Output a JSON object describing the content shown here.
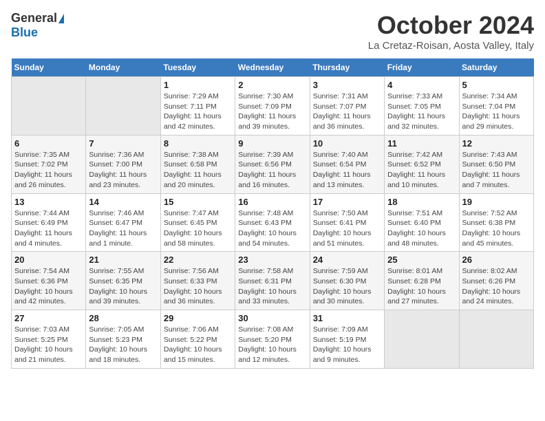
{
  "header": {
    "logo_general": "General",
    "logo_blue": "Blue",
    "month": "October 2024",
    "location": "La Cretaz-Roisan, Aosta Valley, Italy"
  },
  "calendar": {
    "weekdays": [
      "Sunday",
      "Monday",
      "Tuesday",
      "Wednesday",
      "Thursday",
      "Friday",
      "Saturday"
    ],
    "rows": [
      [
        {
          "day": "",
          "detail": ""
        },
        {
          "day": "",
          "detail": ""
        },
        {
          "day": "1",
          "detail": "Sunrise: 7:29 AM\nSunset: 7:11 PM\nDaylight: 11 hours and 42 minutes."
        },
        {
          "day": "2",
          "detail": "Sunrise: 7:30 AM\nSunset: 7:09 PM\nDaylight: 11 hours and 39 minutes."
        },
        {
          "day": "3",
          "detail": "Sunrise: 7:31 AM\nSunset: 7:07 PM\nDaylight: 11 hours and 36 minutes."
        },
        {
          "day": "4",
          "detail": "Sunrise: 7:33 AM\nSunset: 7:05 PM\nDaylight: 11 hours and 32 minutes."
        },
        {
          "day": "5",
          "detail": "Sunrise: 7:34 AM\nSunset: 7:04 PM\nDaylight: 11 hours and 29 minutes."
        }
      ],
      [
        {
          "day": "6",
          "detail": "Sunrise: 7:35 AM\nSunset: 7:02 PM\nDaylight: 11 hours and 26 minutes."
        },
        {
          "day": "7",
          "detail": "Sunrise: 7:36 AM\nSunset: 7:00 PM\nDaylight: 11 hours and 23 minutes."
        },
        {
          "day": "8",
          "detail": "Sunrise: 7:38 AM\nSunset: 6:58 PM\nDaylight: 11 hours and 20 minutes."
        },
        {
          "day": "9",
          "detail": "Sunrise: 7:39 AM\nSunset: 6:56 PM\nDaylight: 11 hours and 16 minutes."
        },
        {
          "day": "10",
          "detail": "Sunrise: 7:40 AM\nSunset: 6:54 PM\nDaylight: 11 hours and 13 minutes."
        },
        {
          "day": "11",
          "detail": "Sunrise: 7:42 AM\nSunset: 6:52 PM\nDaylight: 11 hours and 10 minutes."
        },
        {
          "day": "12",
          "detail": "Sunrise: 7:43 AM\nSunset: 6:50 PM\nDaylight: 11 hours and 7 minutes."
        }
      ],
      [
        {
          "day": "13",
          "detail": "Sunrise: 7:44 AM\nSunset: 6:49 PM\nDaylight: 11 hours and 4 minutes."
        },
        {
          "day": "14",
          "detail": "Sunrise: 7:46 AM\nSunset: 6:47 PM\nDaylight: 11 hours and 1 minute."
        },
        {
          "day": "15",
          "detail": "Sunrise: 7:47 AM\nSunset: 6:45 PM\nDaylight: 10 hours and 58 minutes."
        },
        {
          "day": "16",
          "detail": "Sunrise: 7:48 AM\nSunset: 6:43 PM\nDaylight: 10 hours and 54 minutes."
        },
        {
          "day": "17",
          "detail": "Sunrise: 7:50 AM\nSunset: 6:41 PM\nDaylight: 10 hours and 51 minutes."
        },
        {
          "day": "18",
          "detail": "Sunrise: 7:51 AM\nSunset: 6:40 PM\nDaylight: 10 hours and 48 minutes."
        },
        {
          "day": "19",
          "detail": "Sunrise: 7:52 AM\nSunset: 6:38 PM\nDaylight: 10 hours and 45 minutes."
        }
      ],
      [
        {
          "day": "20",
          "detail": "Sunrise: 7:54 AM\nSunset: 6:36 PM\nDaylight: 10 hours and 42 minutes."
        },
        {
          "day": "21",
          "detail": "Sunrise: 7:55 AM\nSunset: 6:35 PM\nDaylight: 10 hours and 39 minutes."
        },
        {
          "day": "22",
          "detail": "Sunrise: 7:56 AM\nSunset: 6:33 PM\nDaylight: 10 hours and 36 minutes."
        },
        {
          "day": "23",
          "detail": "Sunrise: 7:58 AM\nSunset: 6:31 PM\nDaylight: 10 hours and 33 minutes."
        },
        {
          "day": "24",
          "detail": "Sunrise: 7:59 AM\nSunset: 6:30 PM\nDaylight: 10 hours and 30 minutes."
        },
        {
          "day": "25",
          "detail": "Sunrise: 8:01 AM\nSunset: 6:28 PM\nDaylight: 10 hours and 27 minutes."
        },
        {
          "day": "26",
          "detail": "Sunrise: 8:02 AM\nSunset: 6:26 PM\nDaylight: 10 hours and 24 minutes."
        }
      ],
      [
        {
          "day": "27",
          "detail": "Sunrise: 7:03 AM\nSunset: 5:25 PM\nDaylight: 10 hours and 21 minutes."
        },
        {
          "day": "28",
          "detail": "Sunrise: 7:05 AM\nSunset: 5:23 PM\nDaylight: 10 hours and 18 minutes."
        },
        {
          "day": "29",
          "detail": "Sunrise: 7:06 AM\nSunset: 5:22 PM\nDaylight: 10 hours and 15 minutes."
        },
        {
          "day": "30",
          "detail": "Sunrise: 7:08 AM\nSunset: 5:20 PM\nDaylight: 10 hours and 12 minutes."
        },
        {
          "day": "31",
          "detail": "Sunrise: 7:09 AM\nSunset: 5:19 PM\nDaylight: 10 hours and 9 minutes."
        },
        {
          "day": "",
          "detail": ""
        },
        {
          "day": "",
          "detail": ""
        }
      ]
    ]
  }
}
